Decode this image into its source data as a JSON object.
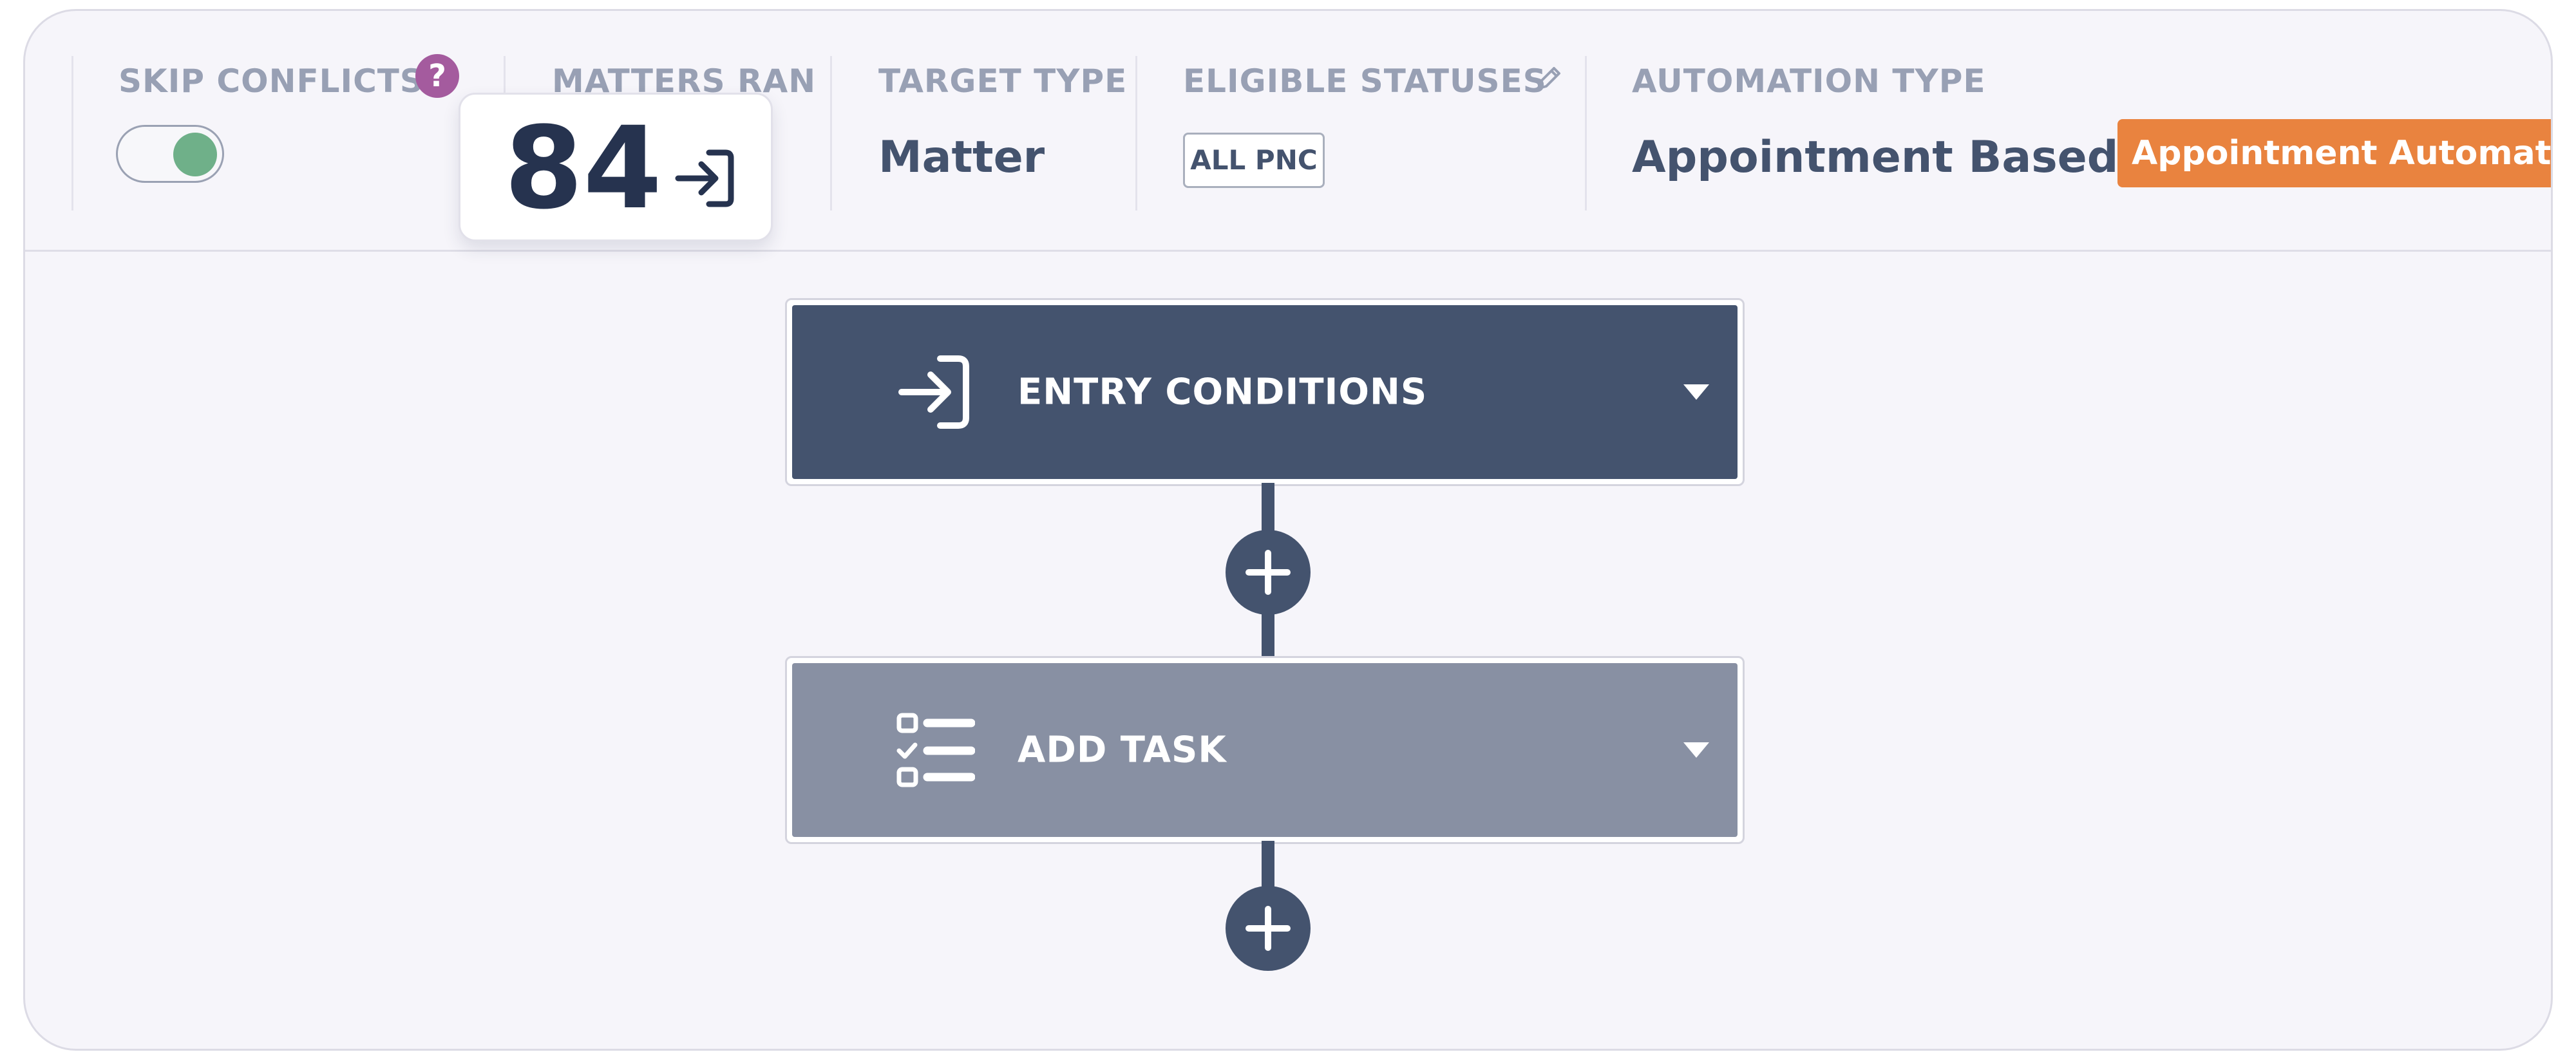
{
  "header": {
    "skip_conflicts": {
      "label": "SKIP CONFLICTS",
      "help_glyph": "?",
      "enabled": true
    },
    "matters_ran": {
      "label": "MATTERS RAN",
      "count": "84"
    },
    "target_type": {
      "label": "TARGET TYPE",
      "value": "Matter"
    },
    "eligible_statuses": {
      "label": "ELIGIBLE STATUSES",
      "chips": [
        "ALL PNC"
      ]
    },
    "automation_type": {
      "label": "AUTOMATION TYPE",
      "value": "Appointment Based",
      "badge": "Appointment Automations"
    }
  },
  "workflow": {
    "nodes": [
      {
        "title": "ENTRY CONDITIONS",
        "icon": "entry-arrow-icon"
      },
      {
        "title": "ADD TASK",
        "icon": "checklist-icon"
      }
    ]
  },
  "colors": {
    "card_bg": "#f6f5fa",
    "entry_node": "#44536e",
    "task_node": "#8890a3",
    "accent_orange": "#e9833f",
    "help_purple": "#a45b9e",
    "toggle_on": "#6fb089"
  }
}
